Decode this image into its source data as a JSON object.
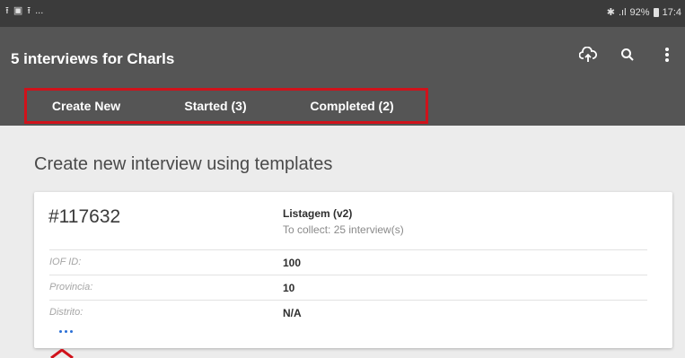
{
  "status_bar": {
    "left_icons": [
      "upload-icon",
      "image-icon",
      "upload-icon"
    ],
    "ellipsis": "...",
    "signal": ".ıl",
    "battery": "92%",
    "time": "17:4"
  },
  "app_bar": {
    "title": "5 interviews for Charls",
    "actions": [
      "cloud-sync-icon",
      "search-icon",
      "overflow-menu-icon"
    ]
  },
  "tabs": [
    {
      "label": "Create New",
      "selected": true
    },
    {
      "label": "Started (3)",
      "selected": false
    },
    {
      "label": "Completed (2)",
      "selected": false
    }
  ],
  "section_heading": "Create new interview using templates",
  "card": {
    "id": "#117632",
    "template_name": "Listagem (v2)",
    "template_sub": "To collect: 25 interview(s)",
    "rows": [
      {
        "label": "IOF ID:",
        "value": "100"
      },
      {
        "label": "Provincia:",
        "value": "10"
      },
      {
        "label": "Distrito:",
        "value": "N/A"
      }
    ]
  },
  "colors": {
    "app_bar": "#555555",
    "status_bar": "#3b3b3b",
    "annotation_red": "#d0121b",
    "link_blue": "#2a6fd6"
  }
}
